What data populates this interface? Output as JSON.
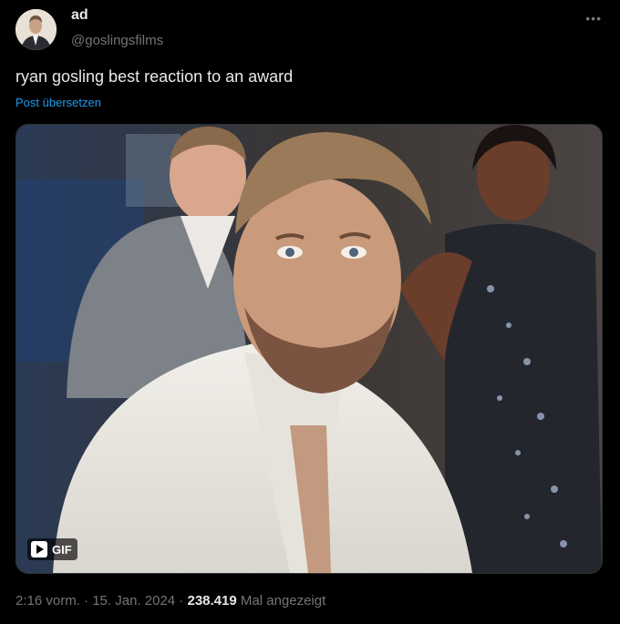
{
  "author": {
    "display_name": "ad",
    "handle": "@goslingsfilms"
  },
  "more_icon": "more-horizontal-icon",
  "post": {
    "text": "ryan gosling best reaction to an award",
    "translate_link": "Post übersetzen"
  },
  "media": {
    "badge_label": "GIF",
    "badge_icon": "play-icon"
  },
  "meta": {
    "time": "2:16 vorm.",
    "separator1": " · ",
    "date": "15. Jan. 2024",
    "separator2": " · ",
    "views": "238.419",
    "views_label": " Mal angezeigt"
  },
  "colors": {
    "background": "#000000",
    "text": "#e7e9ea",
    "secondary": "#71767b",
    "link": "#1d9bf0"
  }
}
